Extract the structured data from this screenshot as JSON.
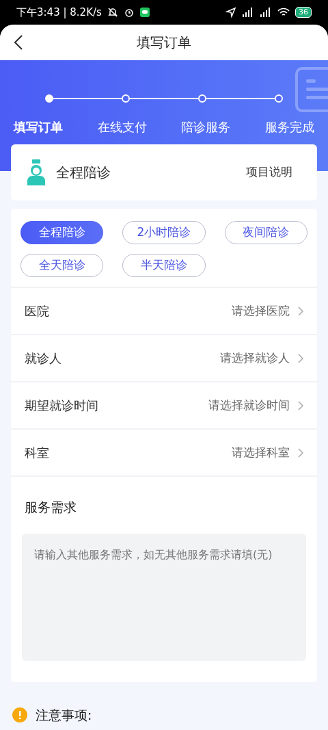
{
  "status_bar": {
    "time": "下午3:43 | 8.2K/s",
    "battery": "36"
  },
  "header": {
    "title": "填写订单"
  },
  "steps": [
    {
      "label": "填写订单",
      "selected": true
    },
    {
      "label": "在线支付",
      "selected": false
    },
    {
      "label": "陪诊服务",
      "selected": false
    },
    {
      "label": "服务完成",
      "selected": false
    }
  ],
  "service_card": {
    "name": "全程陪诊",
    "link": "项目说明"
  },
  "chips": [
    {
      "label": "全程陪诊",
      "selected": true
    },
    {
      "label": "2小时陪诊",
      "selected": false
    },
    {
      "label": "夜间陪诊",
      "selected": false
    },
    {
      "label": "全天陪诊",
      "selected": false
    },
    {
      "label": "半天陪诊",
      "selected": false
    }
  ],
  "fields": [
    {
      "label": "医院",
      "placeholder": "请选择医院"
    },
    {
      "label": "就诊人",
      "placeholder": "请选择就诊人"
    },
    {
      "label": "期望就诊时间",
      "placeholder": "请选择就诊时间"
    },
    {
      "label": "科室",
      "placeholder": "请选择科室"
    }
  ],
  "needs": {
    "title": "服务需求",
    "placeholder": "请输入其他服务需求，如无其他服务需求请填(无)"
  },
  "notice": {
    "title": "注意事项:"
  }
}
